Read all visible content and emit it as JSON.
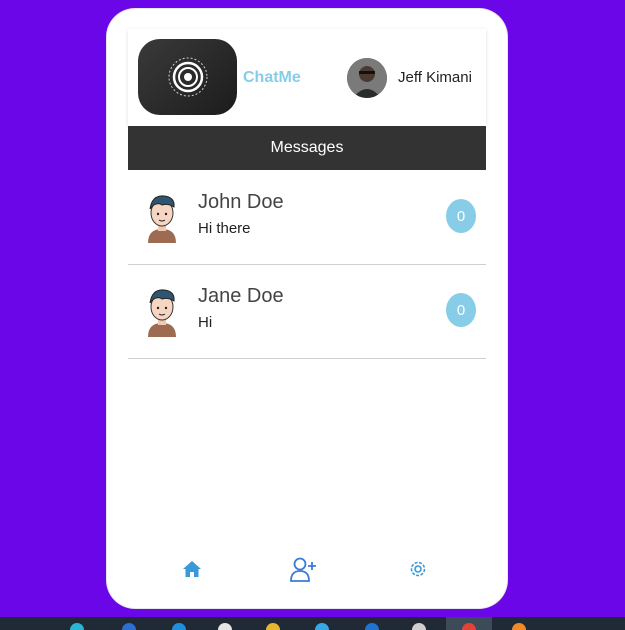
{
  "header": {
    "brand": "ChatMe",
    "user_name": "Jeff Kimani"
  },
  "messages_bar": {
    "title": "Messages"
  },
  "conversations": [
    {
      "name": "John Doe",
      "preview": "Hi there",
      "unread": "0"
    },
    {
      "name": "Jane Doe",
      "preview": "Hi",
      "unread": "0"
    }
  ],
  "nav": {
    "icons": [
      "home-icon",
      "add-user-icon",
      "settings-icon"
    ]
  },
  "colors": {
    "background": "#6a06e8",
    "accent": "#87cde8",
    "messages_bar": "#333333"
  }
}
